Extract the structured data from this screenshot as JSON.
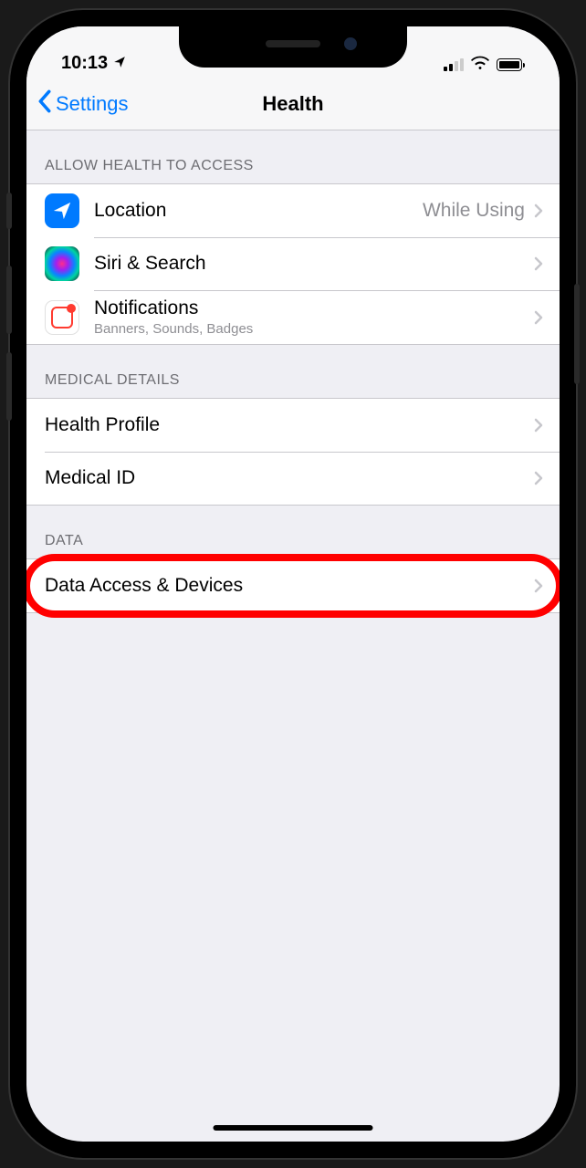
{
  "status": {
    "time": "10:13"
  },
  "nav": {
    "back_label": "Settings",
    "title": "Health"
  },
  "sections": {
    "access": {
      "header": "ALLOW HEALTH TO ACCESS",
      "items": {
        "location": {
          "label": "Location",
          "value": "While Using"
        },
        "siri": {
          "label": "Siri & Search"
        },
        "notifications": {
          "label": "Notifications",
          "sublabel": "Banners, Sounds, Badges"
        }
      }
    },
    "medical": {
      "header": "MEDICAL DETAILS",
      "items": {
        "profile": {
          "label": "Health Profile"
        },
        "medical_id": {
          "label": "Medical ID"
        }
      }
    },
    "data": {
      "header": "DATA",
      "items": {
        "devices": {
          "label": "Data Access & Devices"
        }
      }
    }
  }
}
